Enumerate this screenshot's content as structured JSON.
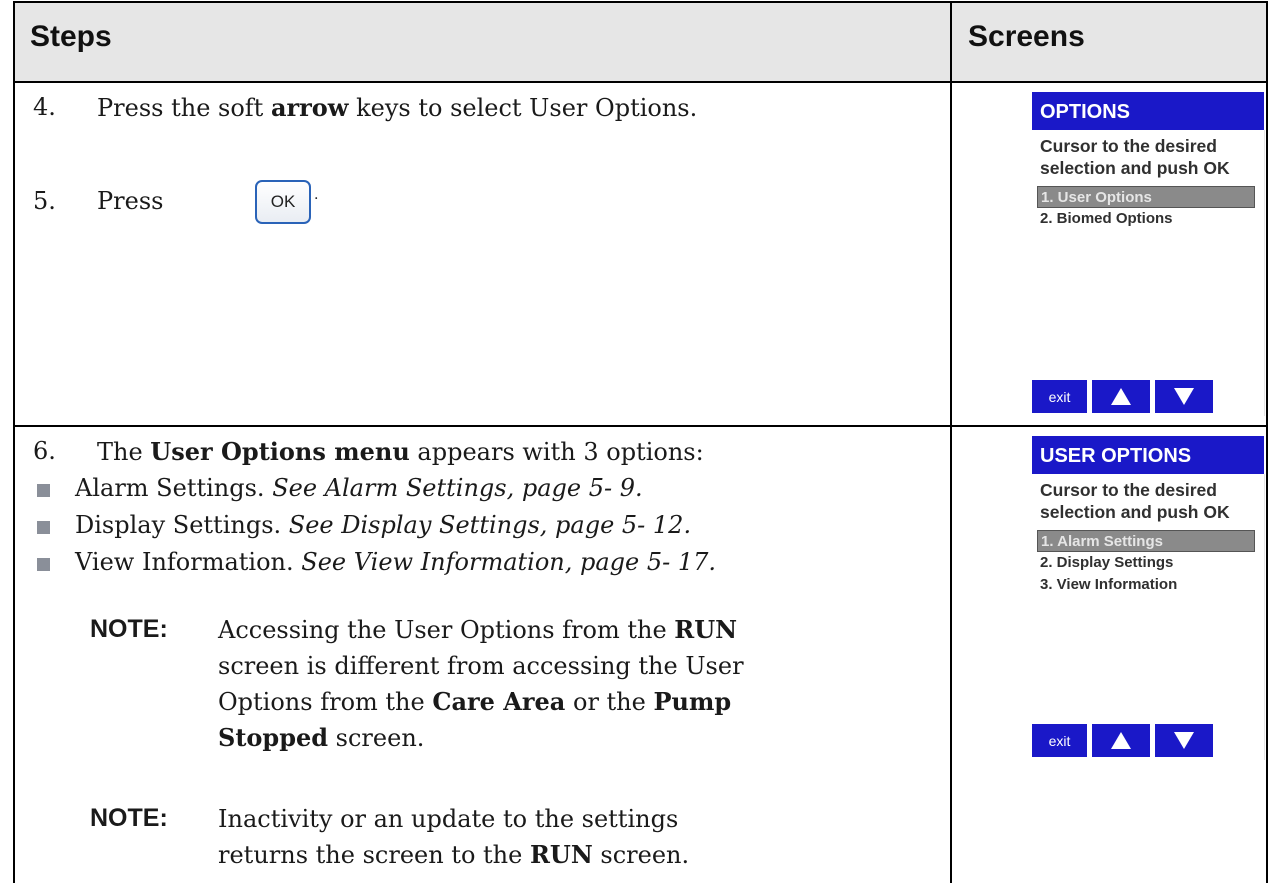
{
  "header": {
    "steps_label": "Steps",
    "screens_label": "Screens"
  },
  "row1": {
    "step4": {
      "number": "4.",
      "text_before": "Press the soft ",
      "bold": "arrow",
      "text_after": " keys to select User Options."
    },
    "step5": {
      "number": "5.",
      "text": "Press",
      "ok_label": "OK",
      "period": "."
    },
    "screen": {
      "title": "OPTIONS",
      "instruction": "Cursor to the desired selection and push OK",
      "items": [
        "1. User Options",
        "2. Biomed Options"
      ],
      "selected_index": 0,
      "keys": {
        "exit": "exit",
        "up": "up-arrow-icon",
        "down": "down-arrow-icon"
      }
    }
  },
  "row2": {
    "step6": {
      "number": "6.",
      "text_before": "The ",
      "bold": "User Options menu",
      "text_after": " appears with 3 options:"
    },
    "bullets": [
      {
        "text": "Alarm Settings. ",
        "italic": "See Alarm Settings, page 5- 9."
      },
      {
        "text": "Display Settings. ",
        "italic": "See Display Settings, page 5- 12."
      },
      {
        "text": "View Information. ",
        "italic": "See View Information, page 5- 17."
      }
    ],
    "note1": {
      "label": "NOTE:",
      "p1": "Accessing the User Options from the ",
      "b1": "RUN",
      "p2": " screen is different from accessing the User Options from the ",
      "b2": "Care Area",
      "p3": " or the ",
      "b3": "Pump Stopped",
      "p4": " screen."
    },
    "note2": {
      "label": "NOTE:",
      "p1": "Inactivity or an update to the settings returns the screen to the ",
      "b1": "RUN",
      "p2": " screen."
    },
    "screen": {
      "title": "USER OPTIONS",
      "instruction": "Cursor to the desired selection and push OK",
      "items": [
        "1. Alarm Settings",
        "2. Display Settings",
        "3. View Information"
      ],
      "selected_index": 0,
      "keys": {
        "exit": "exit",
        "up": "up-arrow-icon",
        "down": "down-arrow-icon"
      }
    }
  }
}
